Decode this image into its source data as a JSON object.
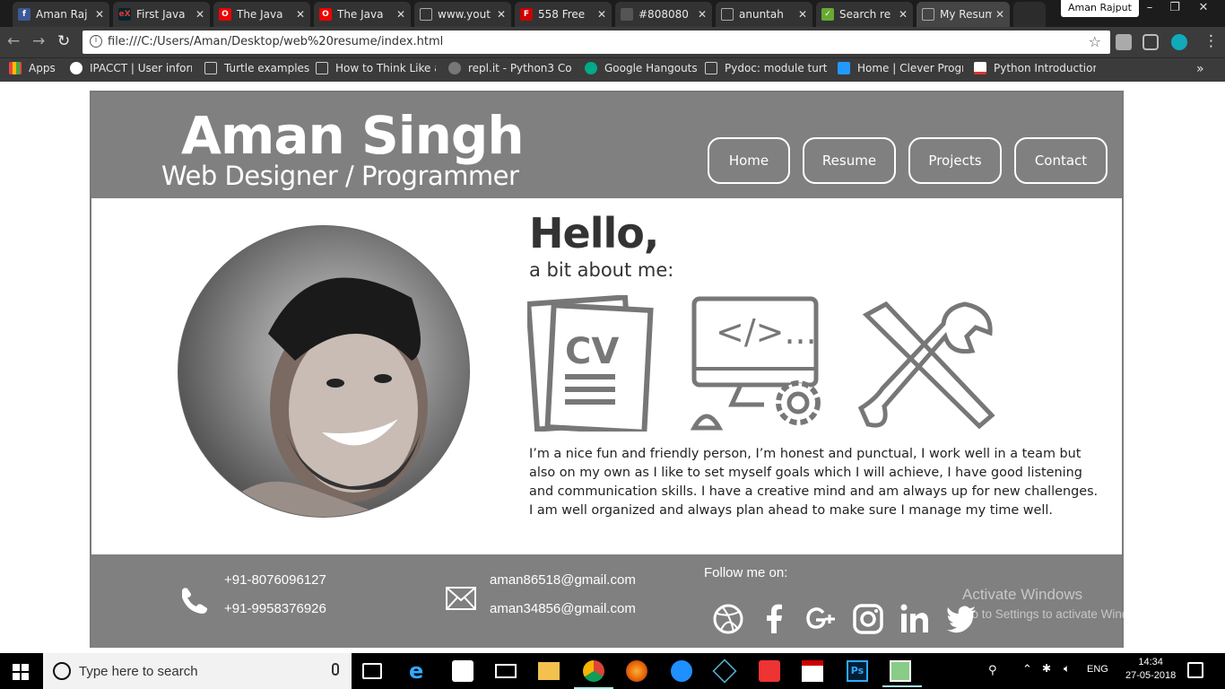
{
  "browser": {
    "tabs": [
      {
        "label": "Aman Raj",
        "icon": "facebook-icon",
        "color": "#3b5998"
      },
      {
        "label": "First Java",
        "icon": "edx-icon",
        "color": "#02262b"
      },
      {
        "label": "The Java",
        "icon": "oracle-icon",
        "color": "#e00"
      },
      {
        "label": "The Java",
        "icon": "oracle-icon",
        "color": "#e00"
      },
      {
        "label": "www.yout",
        "icon": "page-icon",
        "color": "#555"
      },
      {
        "label": "558 Free",
        "icon": "f-icon",
        "color": "#c00"
      },
      {
        "label": "#808080",
        "icon": "color-icon",
        "color": "#555"
      },
      {
        "label": "anuntah",
        "icon": "page-icon",
        "color": "#555"
      },
      {
        "label": "Search re",
        "icon": "search-result-icon",
        "color": "#6a3"
      },
      {
        "label": "My Resum",
        "icon": "page-icon",
        "color": "#555"
      }
    ],
    "profile_name": "Aman Rajput",
    "url": "file:///C:/Users/Aman/Desktop/web%20resume/index.html",
    "bookmarks": [
      "Apps",
      "IPACCT | User inform",
      "Turtle examples",
      "How to Think Like a",
      "repl.it - Python3 Con",
      "Google Hangouts",
      "Pydoc: module turtle",
      "Home | Clever Progr",
      "Python Introduction"
    ],
    "more_bookmarks": "»"
  },
  "resume": {
    "name": "Aman Singh",
    "role": "Web Designer / Programmer",
    "nav": [
      "Home",
      "Resume",
      "Projects",
      "Contact"
    ],
    "hello": "Hello,",
    "about": "a bit about me:",
    "bio": "I’m a nice fun and friendly person, I’m honest and punctual, I work well in a team but also on my own as I like to set myself goals which I will achieve, I have good listening and communication skills. I have a creative mind and am always up for new challenges. I am well organized and always plan ahead to make sure I manage my time well.",
    "icons": [
      "cv-icon",
      "code-monitor-icon",
      "tools-icon"
    ],
    "cv_label": "CV",
    "code_label": "</>...",
    "phones": [
      "+91-8076096127",
      "+91-9958376926"
    ],
    "emails": [
      "aman86518@gmail.com",
      "aman34856@gmail.com"
    ],
    "follow": "Follow me on:",
    "social": [
      "dribbble-icon",
      "facebook-icon",
      "google-plus-icon",
      "instagram-icon",
      "linkedin-icon",
      "twitter-icon"
    ],
    "header_color": "#808080"
  },
  "watermark": {
    "line1": "Activate Windows",
    "line2": "Go to Settings to activate Windows."
  },
  "taskbar": {
    "search_placeholder": "Type here to search",
    "lang": "ENG",
    "time": "14:34",
    "date": "27-05-2018"
  }
}
